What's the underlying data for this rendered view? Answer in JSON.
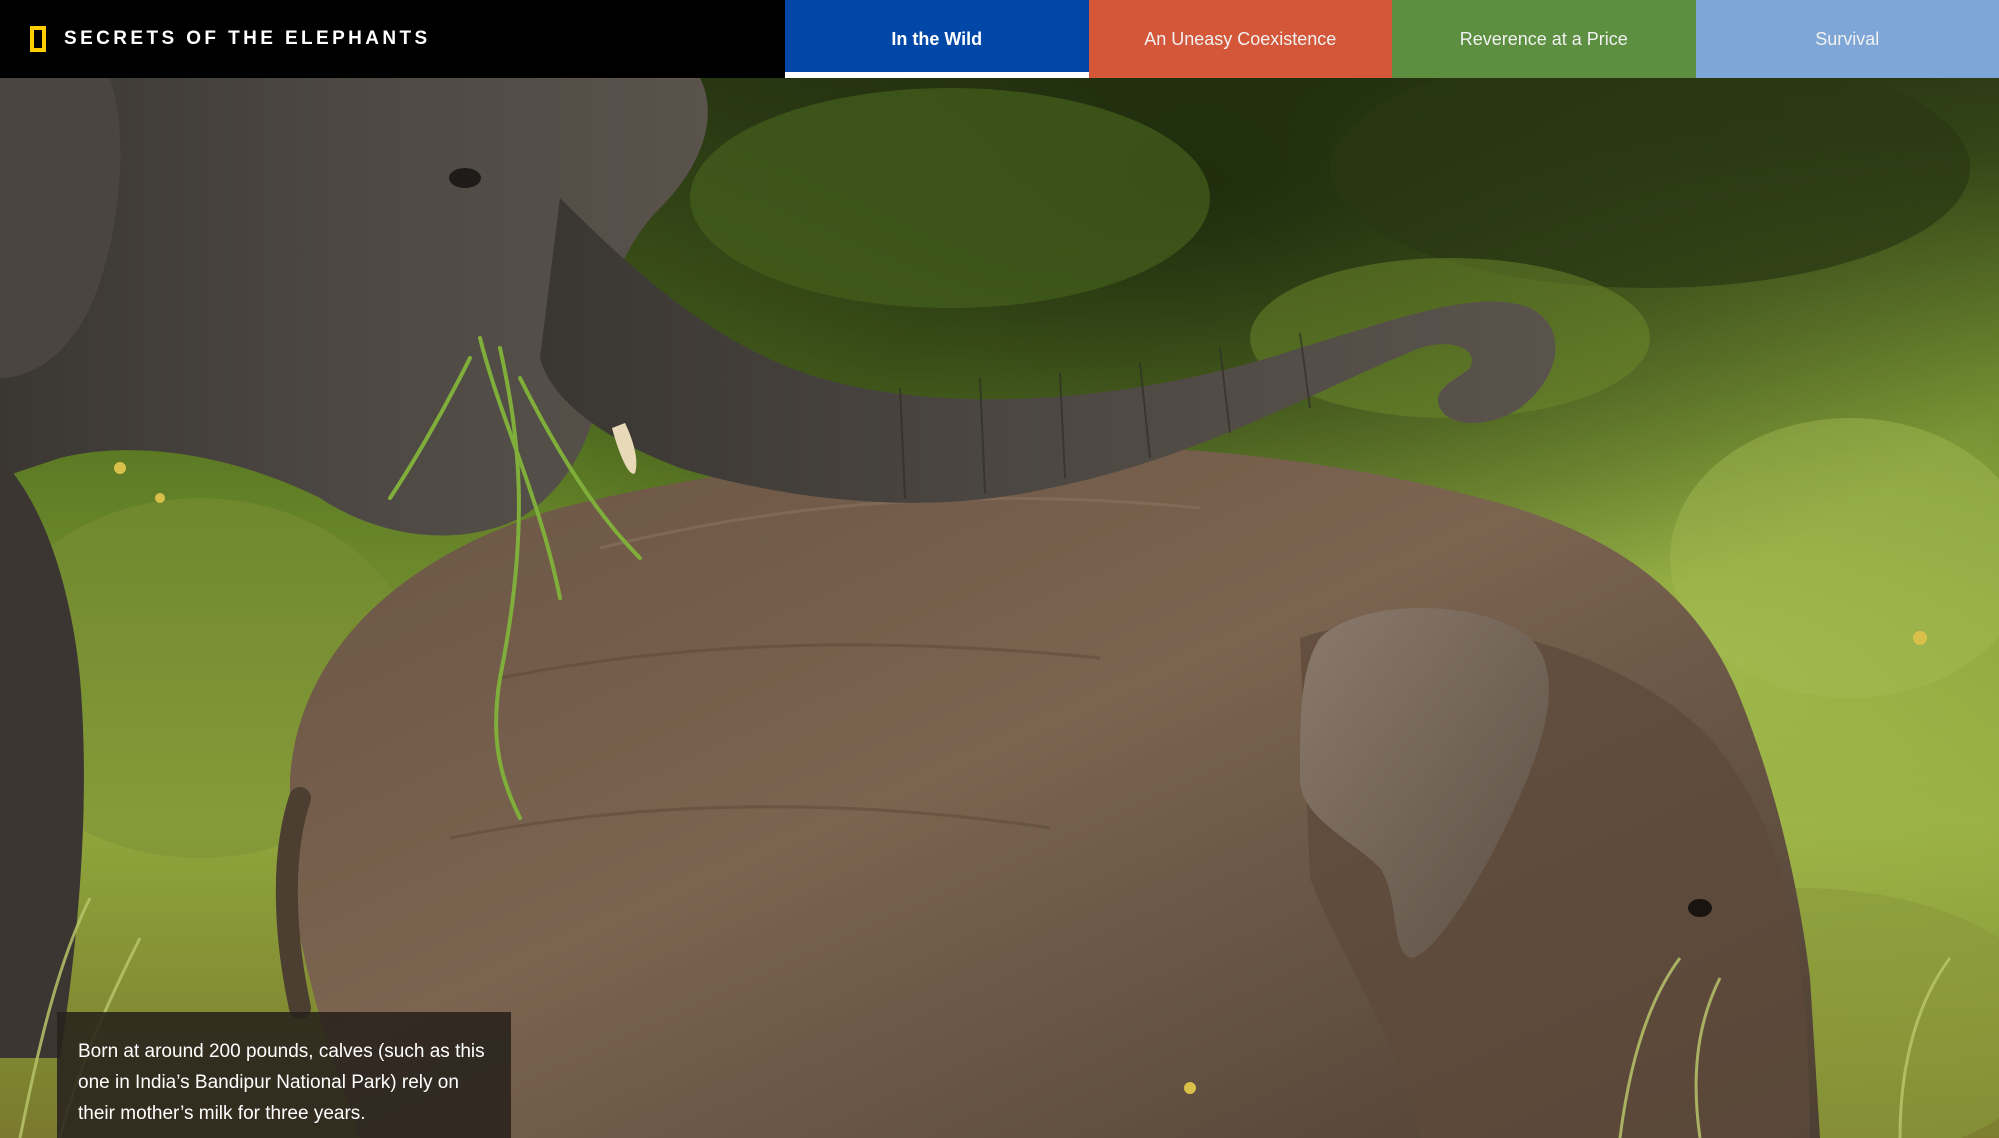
{
  "header": {
    "title": "SECRETS OF THE ELEPHANTS",
    "logo_icon": "yellow-rectangle-logo-icon",
    "logo_color": "#ffce00"
  },
  "tabs": [
    {
      "label": "In the Wild",
      "color": "#0047a8",
      "active": true
    },
    {
      "label": "An Uneasy Coexistence",
      "color": "#d4573a",
      "active": false
    },
    {
      "label": "Reverence at a Price",
      "color": "#5c8f3f",
      "active": false
    },
    {
      "label": "Survival",
      "color": "#7ea6d6",
      "active": false
    }
  ],
  "caption": {
    "text": "Born at around 200 pounds, calves (such as this one in India’s Bandipur National Park) rely on their mother’s milk for three years."
  }
}
